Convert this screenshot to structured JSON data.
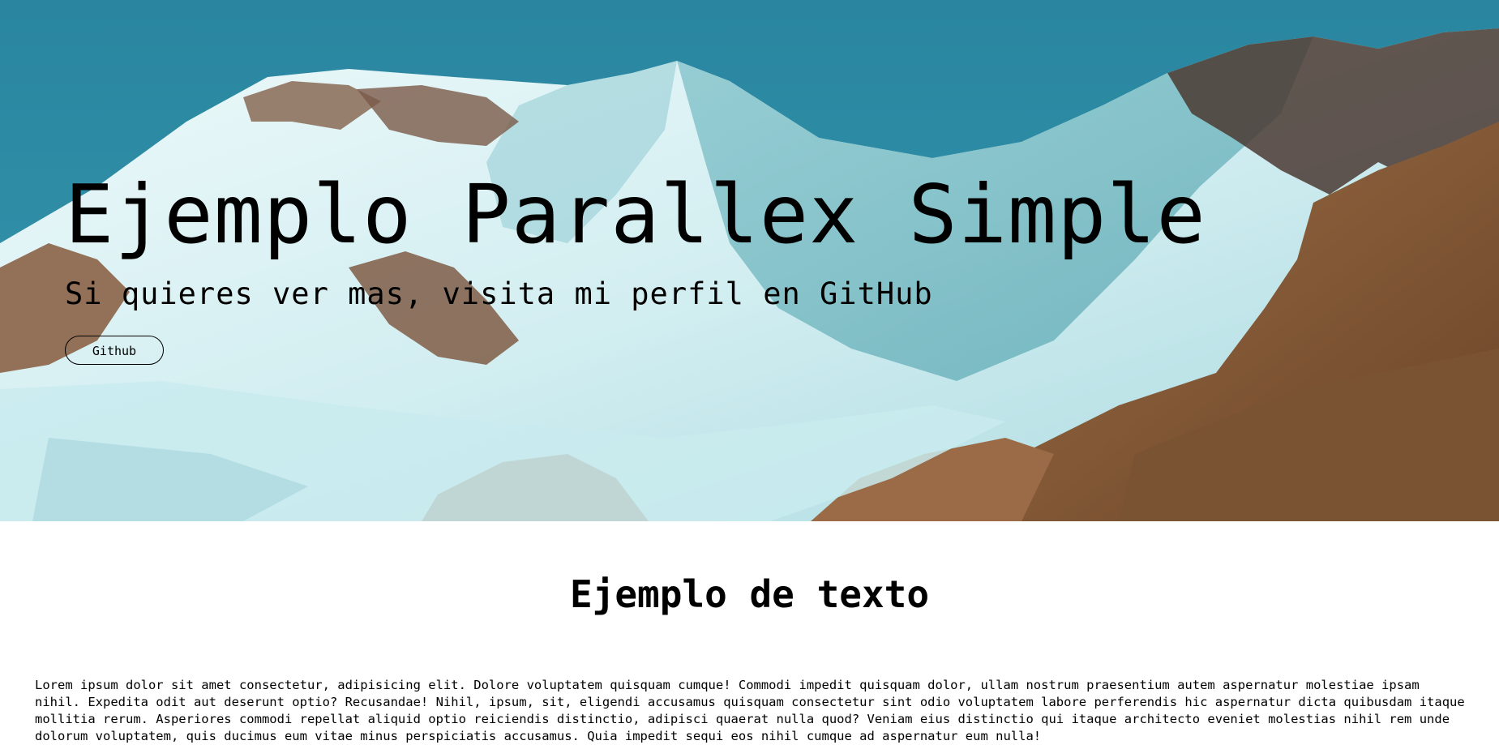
{
  "hero": {
    "title": "Ejemplo Parallex Simple",
    "subtitle": "Si quieres ver mas, visita mi perfil en GitHub",
    "button_label": "Github",
    "colors": {
      "sky": "#2b8aa2",
      "snow": "#d9f3f5",
      "rock": "#8a5e3c"
    }
  },
  "section": {
    "title": "Ejemplo de texto",
    "body": "Lorem ipsum dolor sit amet consectetur, adipisicing elit. Dolore voluptatem quisquam cumque! Commodi impedit quisquam dolor, ullam nostrum praesentium autem aspernatur molestiae ipsam nihil. Expedita odit aut deserunt optio? Recusandae! Nihil, ipsum, sit, eligendi accusamus quisquam consectetur sint odio voluptatem labore perferendis hic aspernatur dicta quibusdam itaque mollitia rerum. Asperiores commodi repellat aliquid optio reiciendis distinctio, adipisci quaerat nulla quod? Veniam eius distinctio qui itaque architecto eveniet molestias nihil rem unde dolorum voluptatem, quis ducimus eum vitae minus perspiciatis accusamus. Quia impedit sequi eos nihil cumque ad aspernatur eum nulla!"
  }
}
